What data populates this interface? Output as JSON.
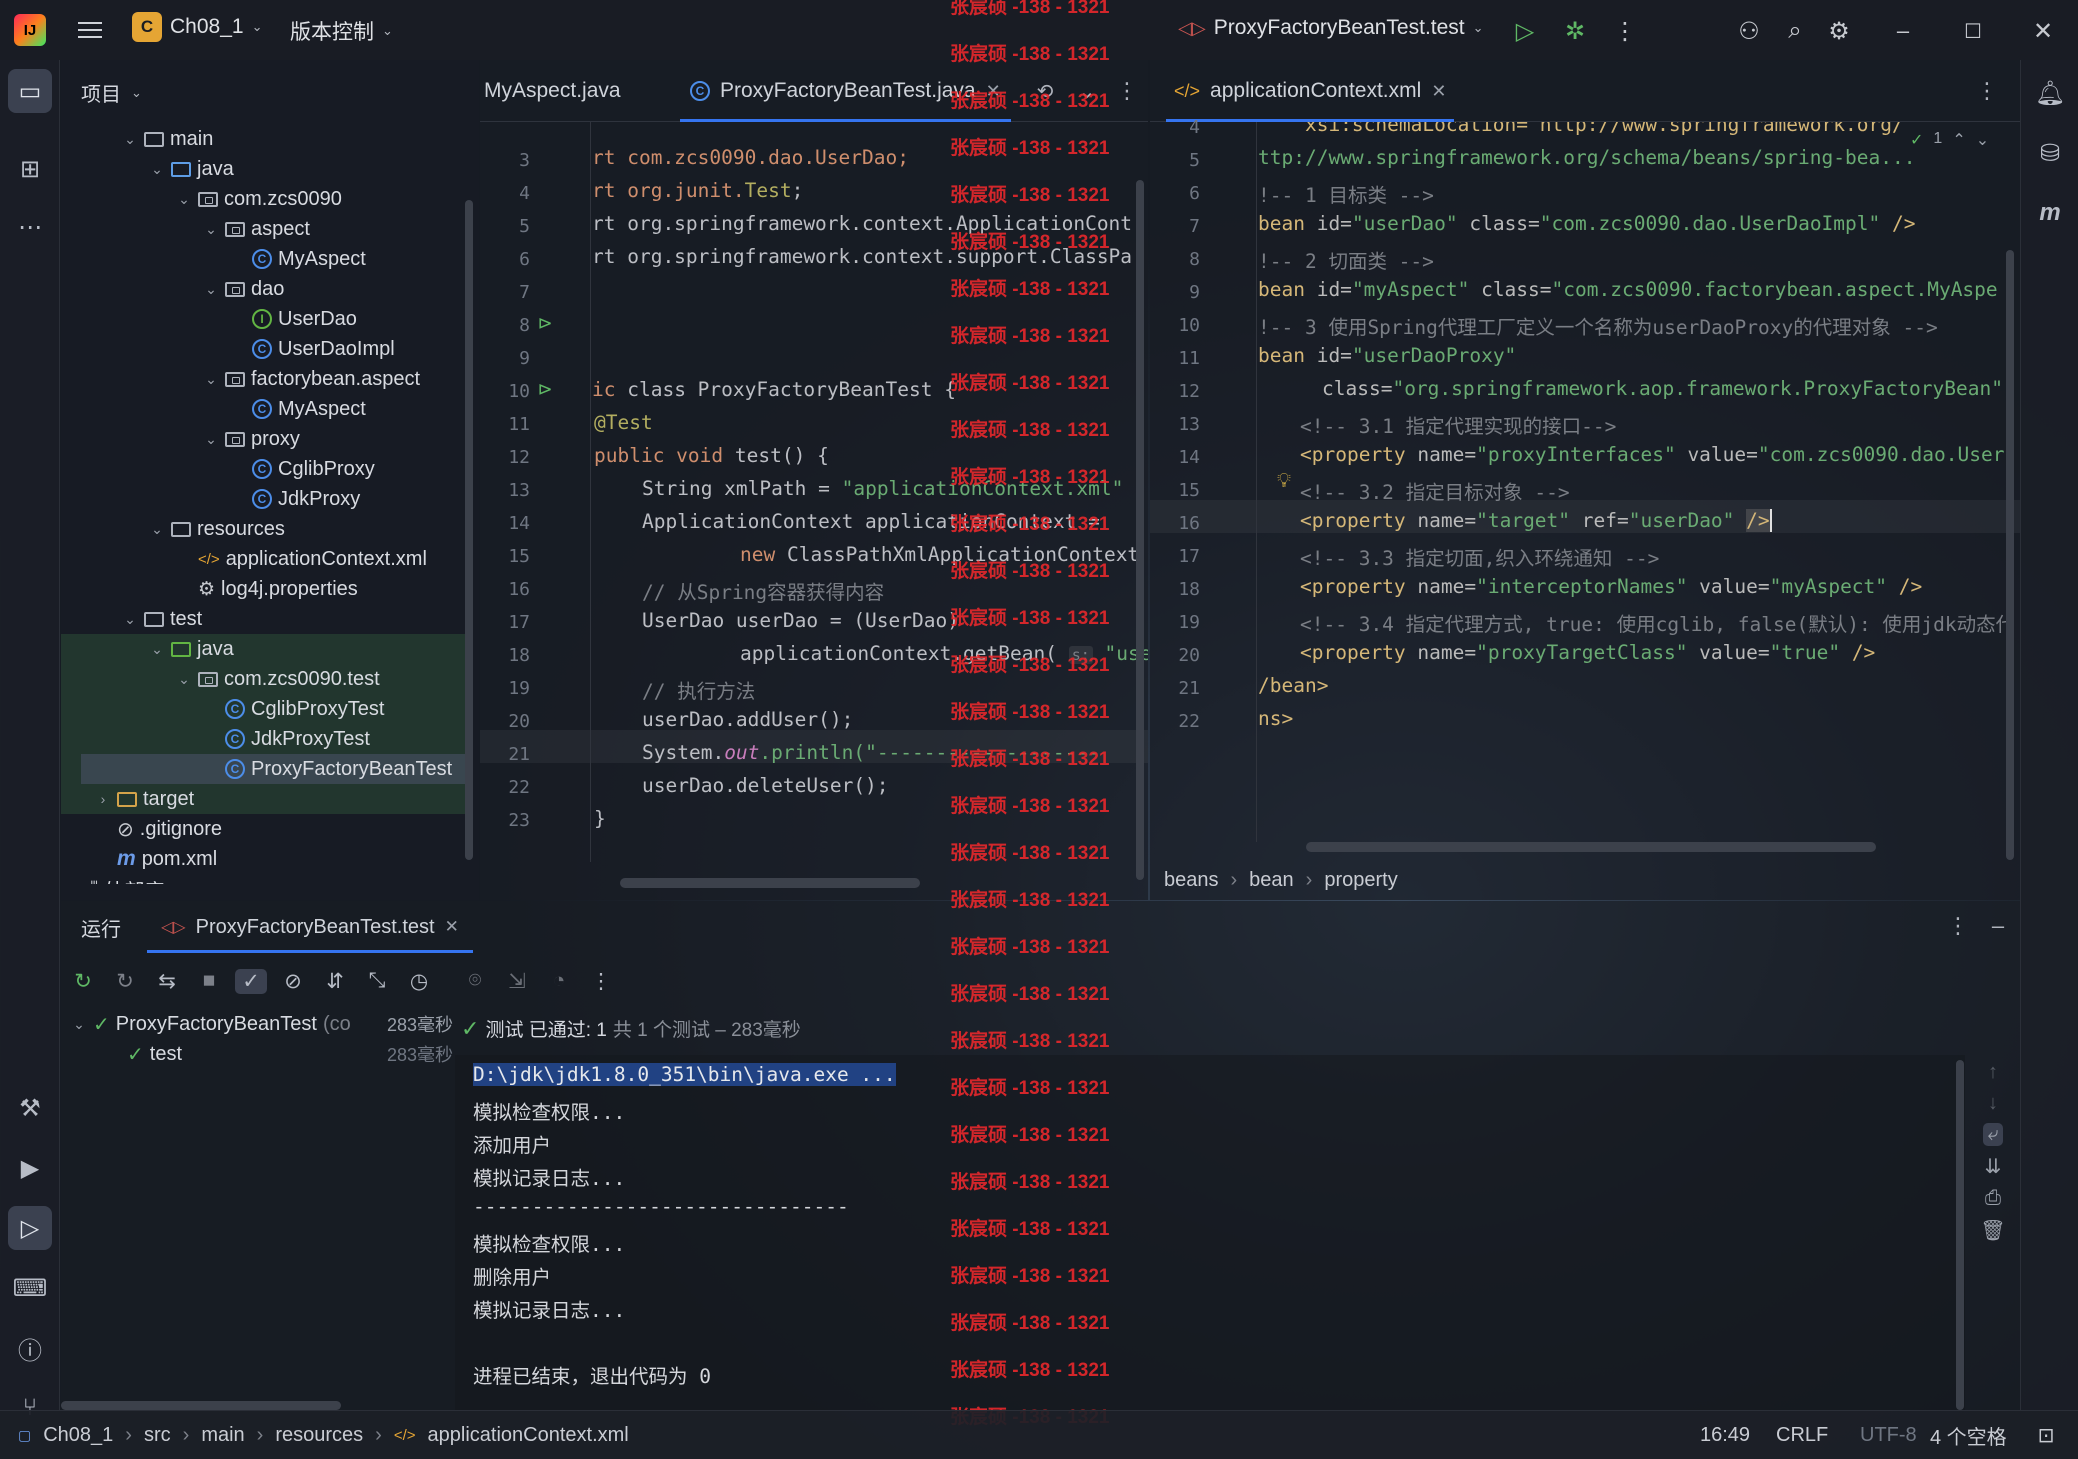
{
  "titlebar": {
    "project_badge": "C",
    "project_name": "Ch08_1",
    "vcs": "版本控制",
    "run_config": "ProxyFactoryBeanTest.test"
  },
  "project_panel": {
    "title": "项目",
    "tree": [
      {
        "label": "main",
        "indent": 3,
        "chev": "v",
        "icon": "folder"
      },
      {
        "label": "java",
        "indent": 4,
        "chev": "v",
        "icon": "folder-blue"
      },
      {
        "label": "com.zcs0090",
        "indent": 5,
        "chev": "v",
        "icon": "package"
      },
      {
        "label": "aspect",
        "indent": 6,
        "chev": "v",
        "icon": "package"
      },
      {
        "label": "MyAspect",
        "indent": 7,
        "chev": "",
        "icon": "class"
      },
      {
        "label": "dao",
        "indent": 6,
        "chev": "v",
        "icon": "package"
      },
      {
        "label": "UserDao",
        "indent": 7,
        "chev": "",
        "icon": "interface"
      },
      {
        "label": "UserDaoImpl",
        "indent": 7,
        "chev": "",
        "icon": "class"
      },
      {
        "label": "factorybean.aspect",
        "indent": 6,
        "chev": "v",
        "icon": "package"
      },
      {
        "label": "MyAspect",
        "indent": 7,
        "chev": "",
        "icon": "class"
      },
      {
        "label": "proxy",
        "indent": 6,
        "chev": "v",
        "icon": "package"
      },
      {
        "label": "CglibProxy",
        "indent": 7,
        "chev": "",
        "icon": "class"
      },
      {
        "label": "JdkProxy",
        "indent": 7,
        "chev": "",
        "icon": "class"
      },
      {
        "label": "resources",
        "indent": 4,
        "chev": "v",
        "icon": "folder"
      },
      {
        "label": "applicationContext.xml",
        "indent": 5,
        "chev": "",
        "icon": "xml"
      },
      {
        "label": "log4j.properties",
        "indent": 5,
        "chev": "",
        "icon": "gear"
      },
      {
        "label": "test",
        "indent": 3,
        "chev": "v",
        "icon": "folder"
      },
      {
        "label": "java",
        "indent": 4,
        "chev": "v",
        "icon": "folder-green"
      },
      {
        "label": "com.zcs0090.test",
        "indent": 5,
        "chev": "v",
        "icon": "package"
      },
      {
        "label": "CglibProxyTest",
        "indent": 6,
        "chev": "",
        "icon": "class"
      },
      {
        "label": "JdkProxyTest",
        "indent": 6,
        "chev": "",
        "icon": "class"
      },
      {
        "label": "ProxyFactoryBeanTest",
        "indent": 6,
        "chev": "",
        "icon": "class"
      },
      {
        "label": "target",
        "indent": 2,
        "chev": ">",
        "icon": "folder-orange"
      },
      {
        "label": ".gitignore",
        "indent": 2,
        "chev": "",
        "icon": "ignore"
      },
      {
        "label": "pom.xml",
        "indent": 2,
        "chev": "",
        "icon": "maven"
      },
      {
        "label": "外部库",
        "indent": 1,
        "chev": ">",
        "icon": "library"
      }
    ]
  },
  "editor_left": {
    "tabs": {
      "t1": "MyAspect.java",
      "t2": "ProxyFactoryBeanTest.java"
    },
    "lines": [
      "3",
      "4",
      "5",
      "6",
      "7",
      "8",
      "9",
      "10",
      "11",
      "12",
      "13",
      "14",
      "15",
      "16",
      "17",
      "18",
      "19",
      "20",
      "21",
      "22",
      "23"
    ],
    "code": {
      "l3": "rt com.zcs0090.dao.UserDao;",
      "l4a": "rt org.junit.",
      "l4b": "Test",
      "l4c": ";",
      "l5": "rt org.springframework.context.ApplicationCont",
      "l6": "rt org.springframework.context.support.ClassPa",
      "l9a": "ic ",
      "l9b": "class ProxyFactoryBeanTest {",
      "l10": "@Test",
      "l11a": "public void ",
      "l11b": "test() {",
      "l12a": "String xmlPath = ",
      "l12b": "\"applicationContext.xml\"",
      "l13": "ApplicationContext applicationContext =",
      "l14a": "new ",
      "l14b": "ClassPathXmlApplicationContext",
      "l15": "// 从Spring容器获得内容",
      "l16": "UserDao userDao = (UserDao)",
      "l17a": "applicationContext.getBean( ",
      "l17b": "s:",
      "l17c": "\"use",
      "l18": "// 执行方法",
      "l19": "userDao.addUser();",
      "l20a": "System.",
      "l20b": "out",
      "l20c": ".println(\"-------------------",
      "l21": "userDao.deleteUser();",
      "l22": "}"
    }
  },
  "editor_right": {
    "tab": "applicationContext.xml",
    "inspection": "1",
    "lines": [
      "4",
      "5",
      "6",
      "7",
      "8",
      "9",
      "10",
      "11",
      "12",
      "13",
      "14",
      "15",
      "16",
      "17",
      "18",
      "19",
      "20",
      "21",
      "22"
    ],
    "code": {
      "l4": "    xsi:schemaLocation=\"http://www.springframework.org/",
      "l5": "ttp://www.springframework.org/schema/beans/spring-bea...",
      "l6": "!-- 1 目标类 -->",
      "l7a": "bean ",
      "l7b": "id=",
      "l7c": "\"userDao\" ",
      "l7d": "class=",
      "l7e": "\"com.zcs0090.dao.UserDaoImpl\"",
      "l7f": " />",
      "l8": "!-- 2 切面类 -->",
      "l9a": "bean ",
      "l9b": "id=",
      "l9c": "\"myAspect\" ",
      "l9d": "class=",
      "l9e": "\"com.zcs0090.factorybean.aspect.MyAspe",
      "l10": "!-- 3 使用Spring代理工厂定义一个名称为userDaoProxy的代理对象 -->",
      "l11a": "bean ",
      "l11b": "id=",
      "l11c": "\"userDaoProxy\"",
      "l12a": "class=",
      "l12b": "\"org.springframework.aop.framework.ProxyFactoryBean\"",
      "l13": "<!-- 3.1 指定代理实现的接口-->",
      "l14a": "<property ",
      "l14b": "name=",
      "l14c": "\"proxyInterfaces\" ",
      "l14d": "value=",
      "l14e": "\"com.zcs0090.dao.User",
      "l15": "<!-- 3.2 指定目标对象 -->",
      "l16a": "<property ",
      "l16b": "name=",
      "l16c": "\"target\" ",
      "l16d": "ref=",
      "l16e": "\"userDao\" ",
      "l16f": "/>",
      "l17": "<!-- 3.3 指定切面,织入环绕通知 -->",
      "l18a": "<property ",
      "l18b": "name=",
      "l18c": "\"interceptorNames\" ",
      "l18d": "value=",
      "l18e": "\"myAspect\"",
      "l18f": " />",
      "l19": "<!-- 3.4 指定代理方式, true: 使用cglib, false(默认): 使用jdk动态代理",
      "l20a": "<property ",
      "l20b": "name=",
      "l20c": "\"proxyTargetClass\" ",
      "l20d": "value=",
      "l20e": "\"true\"",
      "l20f": " />",
      "l21": "/bean>",
      "l22": "ns>"
    },
    "breadcrumbs": [
      "beans",
      "bean",
      "property"
    ]
  },
  "watermark": "张宸硕 -138 - 1321",
  "run": {
    "title": "运行",
    "tab": "ProxyFactoryBeanTest.test",
    "tree_root": "ProxyFactoryBeanTest",
    "tree_root_suffix": "(co",
    "tree_root_time": "283毫秒",
    "tree_child": "test",
    "tree_child_time": "283毫秒",
    "status_pass": "测试 已通过: 1",
    "status_rest": "共 1 个测试 – 283毫秒",
    "console": [
      "D:\\jdk\\jdk1.8.0_351\\bin\\java.exe ...",
      "模拟检查权限...",
      "添加用户",
      "模拟记录日志...",
      "--------------------------------",
      "模拟检查权限...",
      "删除用户",
      "模拟记录日志...",
      "",
      "进程已结束，退出代码为 0"
    ]
  },
  "statusbar": {
    "crumbs": [
      "Ch08_1",
      "src",
      "main",
      "resources",
      "applicationContext.xml"
    ],
    "position": "16:49",
    "line_sep": "CRLF",
    "encoding": "UTF-8",
    "indent": "4 个空格"
  }
}
